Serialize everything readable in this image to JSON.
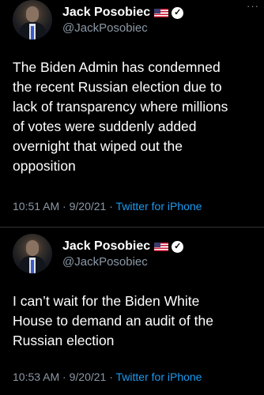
{
  "tweets": [
    {
      "author": {
        "name": "Jack Posobiec",
        "handle": "@JackPosobiec"
      },
      "text": "The Biden Admin has condemned\nthe recent Russian election due to\nlack of transparency where millions\nof votes were suddenly added\novernight that wiped out the\nopposition",
      "time": "10:51 AM",
      "date": "9/20/21",
      "separator": "·",
      "source": "Twitter for iPhone"
    },
    {
      "author": {
        "name": "Jack Posobiec",
        "handle": "@JackPosobiec"
      },
      "text": "I can’t wait for the Biden White\nHouse to demand an audit of the\nRussian election",
      "time": "10:53 AM",
      "date": "9/20/21",
      "separator": "·",
      "source": "Twitter for iPhone"
    }
  ],
  "more_label": "···",
  "icons": {
    "verified": "verified-badge-icon",
    "flag": "us-flag-icon"
  },
  "colors": {
    "background": "#000000",
    "text": "#ffffff",
    "muted": "#8b98a5",
    "link": "#1d9bf0"
  }
}
